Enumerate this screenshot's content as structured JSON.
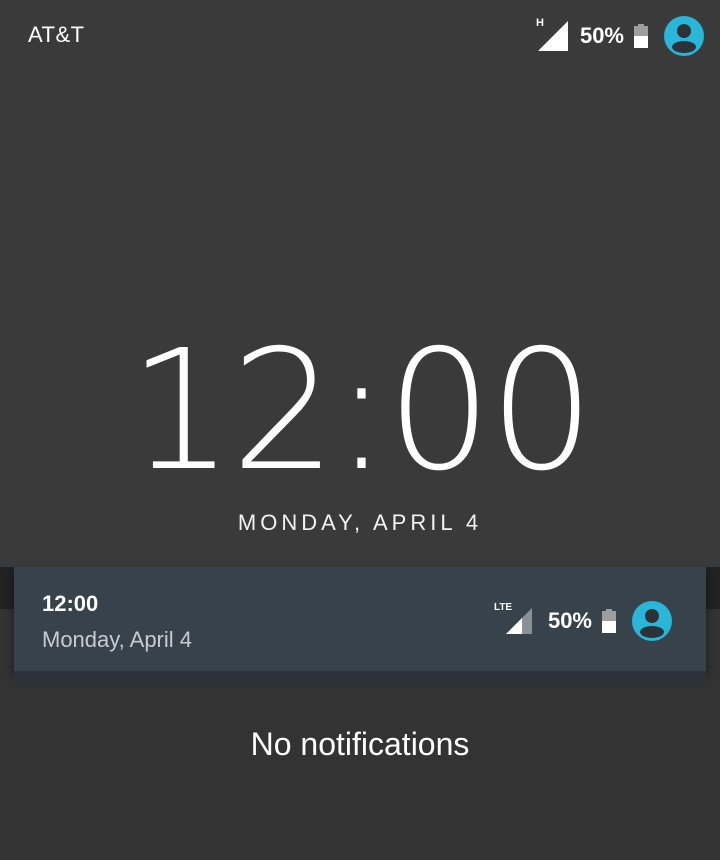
{
  "status_bar": {
    "carrier": "AT&T",
    "network_type": "H",
    "battery_percent": "50%",
    "icons": [
      "signal-icon",
      "battery-icon",
      "user-avatar-icon"
    ]
  },
  "lockscreen": {
    "time": "12:00",
    "date": "MONDAY, APRIL 4"
  },
  "shade_header": {
    "time": "12:00",
    "date": "Monday, April 4",
    "network_type": "LTE",
    "battery_percent": "50%"
  },
  "notifications": {
    "empty_message": "No notifications"
  },
  "colors": {
    "accent": "#29b6d8",
    "panel": "#37424a",
    "background": "#3a3a3a"
  }
}
